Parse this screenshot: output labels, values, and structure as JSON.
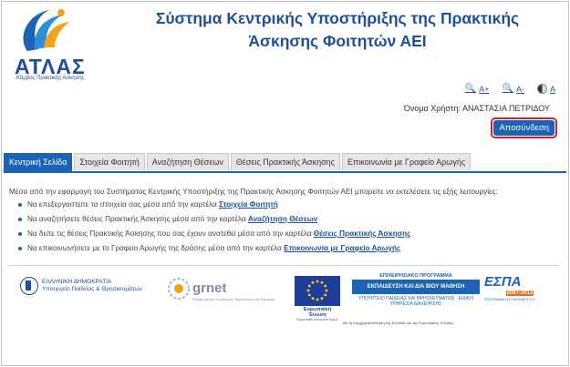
{
  "header": {
    "logo_title": "ΑΤΛΑΣ",
    "logo_subtitle": "Κόμβος Πρακτικής Άσκησης",
    "site_title_line1": "Σύστημα Κεντρικής Υποστήριξης της Πρακτικής",
    "site_title_line2": "Άσκησης Φοιτητών ΑΕΙ"
  },
  "font_tools": {
    "increase": "A+",
    "decrease": "A-",
    "contrast": "A",
    "increase_icon": "magnifier-plus-icon",
    "decrease_icon": "magnifier-minus-icon",
    "contrast_icon": "contrast-icon"
  },
  "user": {
    "username_label": "Όνομα Χρήστη:",
    "username": "ΑΝΑΣΤΑΣΙΑ ΠΕΤΡΙΔΟΥ",
    "logout_label": "Αποσύνδεση"
  },
  "tabs": [
    {
      "label": "Κεντρική Σελίδα",
      "active": true
    },
    {
      "label": "Στοιχεία Φοιτητή",
      "active": false
    },
    {
      "label": "Αναζήτηση Θέσεων",
      "active": false
    },
    {
      "label": "Θέσεις Πρακτικής Άσκησης",
      "active": false
    },
    {
      "label": "Επικοινωνία με Γραφείο Αρωγής",
      "active": false
    }
  ],
  "main": {
    "intro": "Μέσα από την εφαρμογή του Συστήματος Κεντρικής Υποστήριξης της Πρακτικής Άσκησης Φοιτητών ΑΕΙ μπορείτε να εκτελέσετε τις εξής λειτουργίες:",
    "items": [
      {
        "text": "Να επεξεργαστείτε τα στοιχεία σας μέσα από την καρτέλα ",
        "link": "Στοιχεία Φοιτητή"
      },
      {
        "text": "Να αναζητήσετε θέσεις Πρακτικής Άσκησης μέσα από την καρτέλα ",
        "link": "Αναζήτηση Θέσεων"
      },
      {
        "text": "Να δείτε τις θέσεις Πρακτικής Άσκησης που σας έχουν ανατεθεί μέσα από την καρτέλα ",
        "link": "Θέσεις Πρακτικής Άσκησης"
      },
      {
        "text": "Να επικοινωνήσετε με το Γραφείο Αρωγής της δράσης μέσα από την καρτέλα ",
        "link": "Επικοινωνία με Γραφείο Αρωγής"
      }
    ]
  },
  "footer": {
    "gov_line1": "ΕΛΛΗΝΙΚΗ ΔΗΜΟΚΡΑΤΙΑ",
    "gov_line2": "Υπουργείο Παιδείας & Θρησκευμάτων",
    "grnet_name": "grnet",
    "grnet_sub": "Εθνικό Δίκτυο Υποδομών Τεχνολογίας και Έρευνας",
    "eu_caption": "Ευρωπαϊκή Ένωση",
    "eu_sub": "Ευρωπαϊκό Κοινωνικό Ταμείο",
    "program_line1": "ΕΠΙΧΕΙΡΗΣΙΑΚΟ ΠΡΟΓΡΑΜΜΑ",
    "program_band": "ΕΚΠΑΙΔΕΥΣΗ ΚΑΙ ΔΙΑ ΒΙΟΥ ΜΑΘΗΣΗ",
    "program_line3": "ΥΠΟΥΡΓΕΙΟ ΠΑΙΔΕΙΑΣ ΚΑΙ ΘΡΗΣΚΕΥΜΑΤΩΝ · ΕΙΔΙΚΗ ΥΠΗΡΕΣΙΑ ΔΙΑΧΕΙΡΙΣΗΣ",
    "espa_name": "ΕΣΠΑ",
    "espa_years": "2007-2013",
    "espa_tag": "ΠΡΟΓΡΑΜΜΑ ΓΙΑ ΤΗΝ ΑΝΑΠΤΥΞΗ",
    "credit": "Με τη συγχρηματοδότηση της Ελλάδας και της Ευρωπαϊκής Ένωσης"
  },
  "colors": {
    "brand_blue": "#1b63b5",
    "title_blue": "#1e4f9c",
    "logout_outline": "#d3212b",
    "logo_orange": "#f2a31b"
  }
}
